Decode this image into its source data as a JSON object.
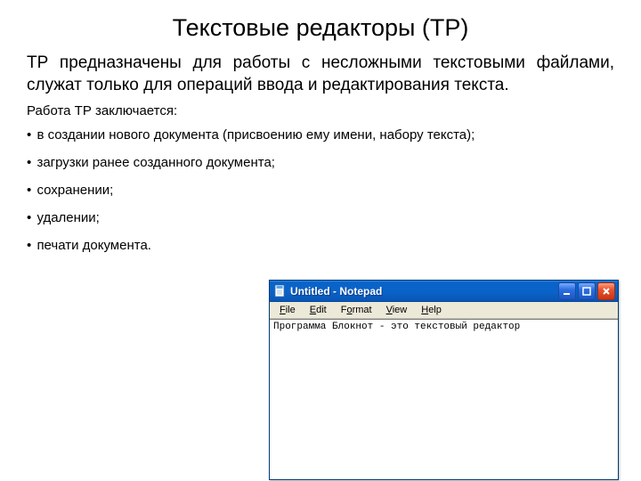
{
  "title": "Текстовые редакторы (ТР)",
  "body": "ТР предназначены для работы с несложными текстовыми файлами, служат только для операций ввода и редактирования текста.",
  "subhead": "Работа ТР заключается:",
  "bullets": [
    "в создании нового документа (присвоению ему имени, набору текста);",
    "загрузки ранее созданного документа;",
    "сохранении;",
    "удалении;",
    "печати документа."
  ],
  "notepad": {
    "title": "Untitled - Notepad",
    "menu": {
      "file": "File",
      "edit": "Edit",
      "format": "Format",
      "view": "View",
      "help": "Help"
    },
    "content": "Программа Блокнот - это текстовый редактор"
  }
}
